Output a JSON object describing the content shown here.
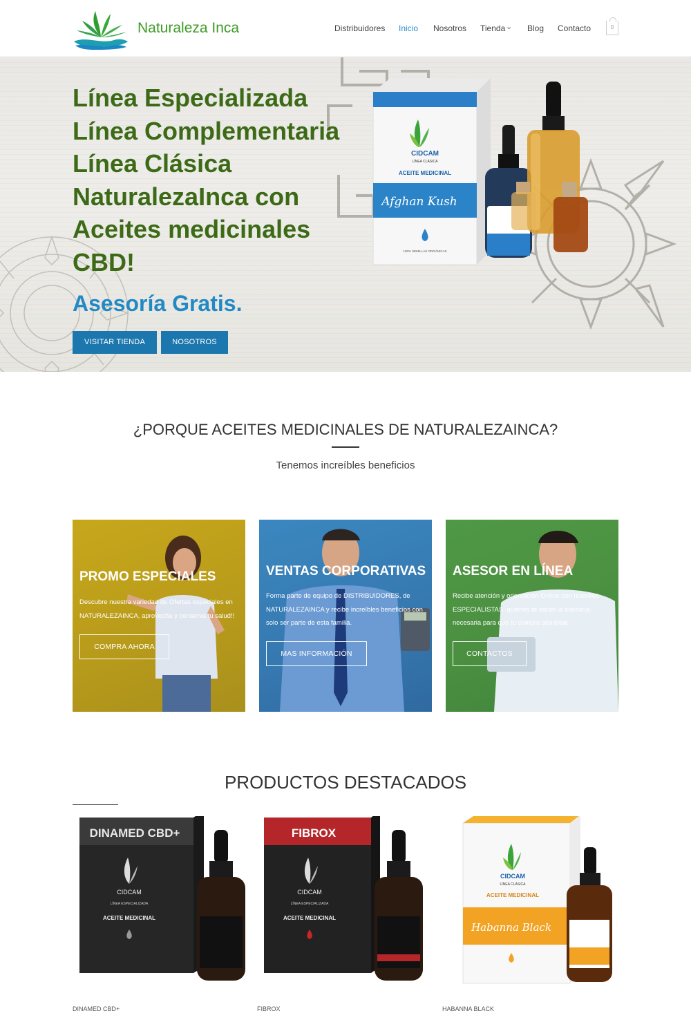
{
  "header": {
    "site_title": "Naturaleza Inca",
    "nav": [
      "Distribuidores",
      "Inicio",
      "Nosotros",
      "Tienda",
      "Blog",
      "Contacto"
    ],
    "tienda_chevron": "⌄",
    "cart_count": "0"
  },
  "hero": {
    "lines": [
      "Línea Especializada",
      "Línea Complementaria",
      "Línea Clásica",
      "NaturalezaInca con",
      "Aceites medicinales",
      "CBD!"
    ],
    "subline": "Asesoría Gratis.",
    "btn_tienda": "VISITAR TIENDA",
    "btn_nosotros": "NOSOTROS",
    "box_brand": "CIDCAM",
    "box_line": "LÍNEA CLÁSICA",
    "box_product": "ACEITE MEDICINAL",
    "box_strain": "Afghan Kush",
    "box_foot": "100% SEMILLAS ORGÁNICAS"
  },
  "benefits": {
    "title": "¿PORQUE ACEITES MEDICINALES DE NATURALEZAINCA?",
    "subtitle": "Tenemos increíbles beneficios",
    "cards": [
      {
        "title": "PROMO ESPECIALES",
        "text": "Descubre nuestra variedad de Ofertas especiales en NATURALEZAINCA, aprovecha y conserva tu salud!!",
        "button": "COMPRA AHORA"
      },
      {
        "title": "VENTAS CORPORATIVAS",
        "text": "Forma parte de equipo de DISTRIBUIDORES, de NATURALEZAINCA y recibe increíbles beneficios con solo ser parte de esta familia.",
        "button": "MAS INFORMACIÓN"
      },
      {
        "title": "ASESOR EN LÍNEA",
        "text": "Recibe atención y orientación Online con nuestros ESPECIALISTAS, quienes te darán la asesoría necesaria para que tu compra sea ideal.",
        "button": "CONTACTOS"
      }
    ]
  },
  "products": {
    "title": "PRODUCTOS DESTACADOS",
    "items": [
      {
        "box_name": "DINAMED CBD+",
        "brand": "CIDCAM",
        "line": "LÍNEA ESPECIALIZADA",
        "type": "ACEITE MEDICINAL",
        "caption": "DINAMED CBD+"
      },
      {
        "box_name": "FIBROX",
        "brand": "CIDCAM",
        "line": "LÍNEA ESPECIALIZADA",
        "type": "ACEITE MEDICINAL",
        "caption": "FIBROX"
      },
      {
        "box_name": "Habanna Black",
        "brand": "CIDCAM",
        "line": "LÍNEA CLÁSICA",
        "type": "ACEITE MEDICINAL",
        "caption": "HABANNA BLACK"
      }
    ]
  },
  "colors": {
    "brand_green": "#3c6a16",
    "accent_blue": "#1c77ae",
    "card_yellow": "#c7a71b",
    "card_blue": "#3b87bf",
    "card_green": "#4f9845"
  }
}
